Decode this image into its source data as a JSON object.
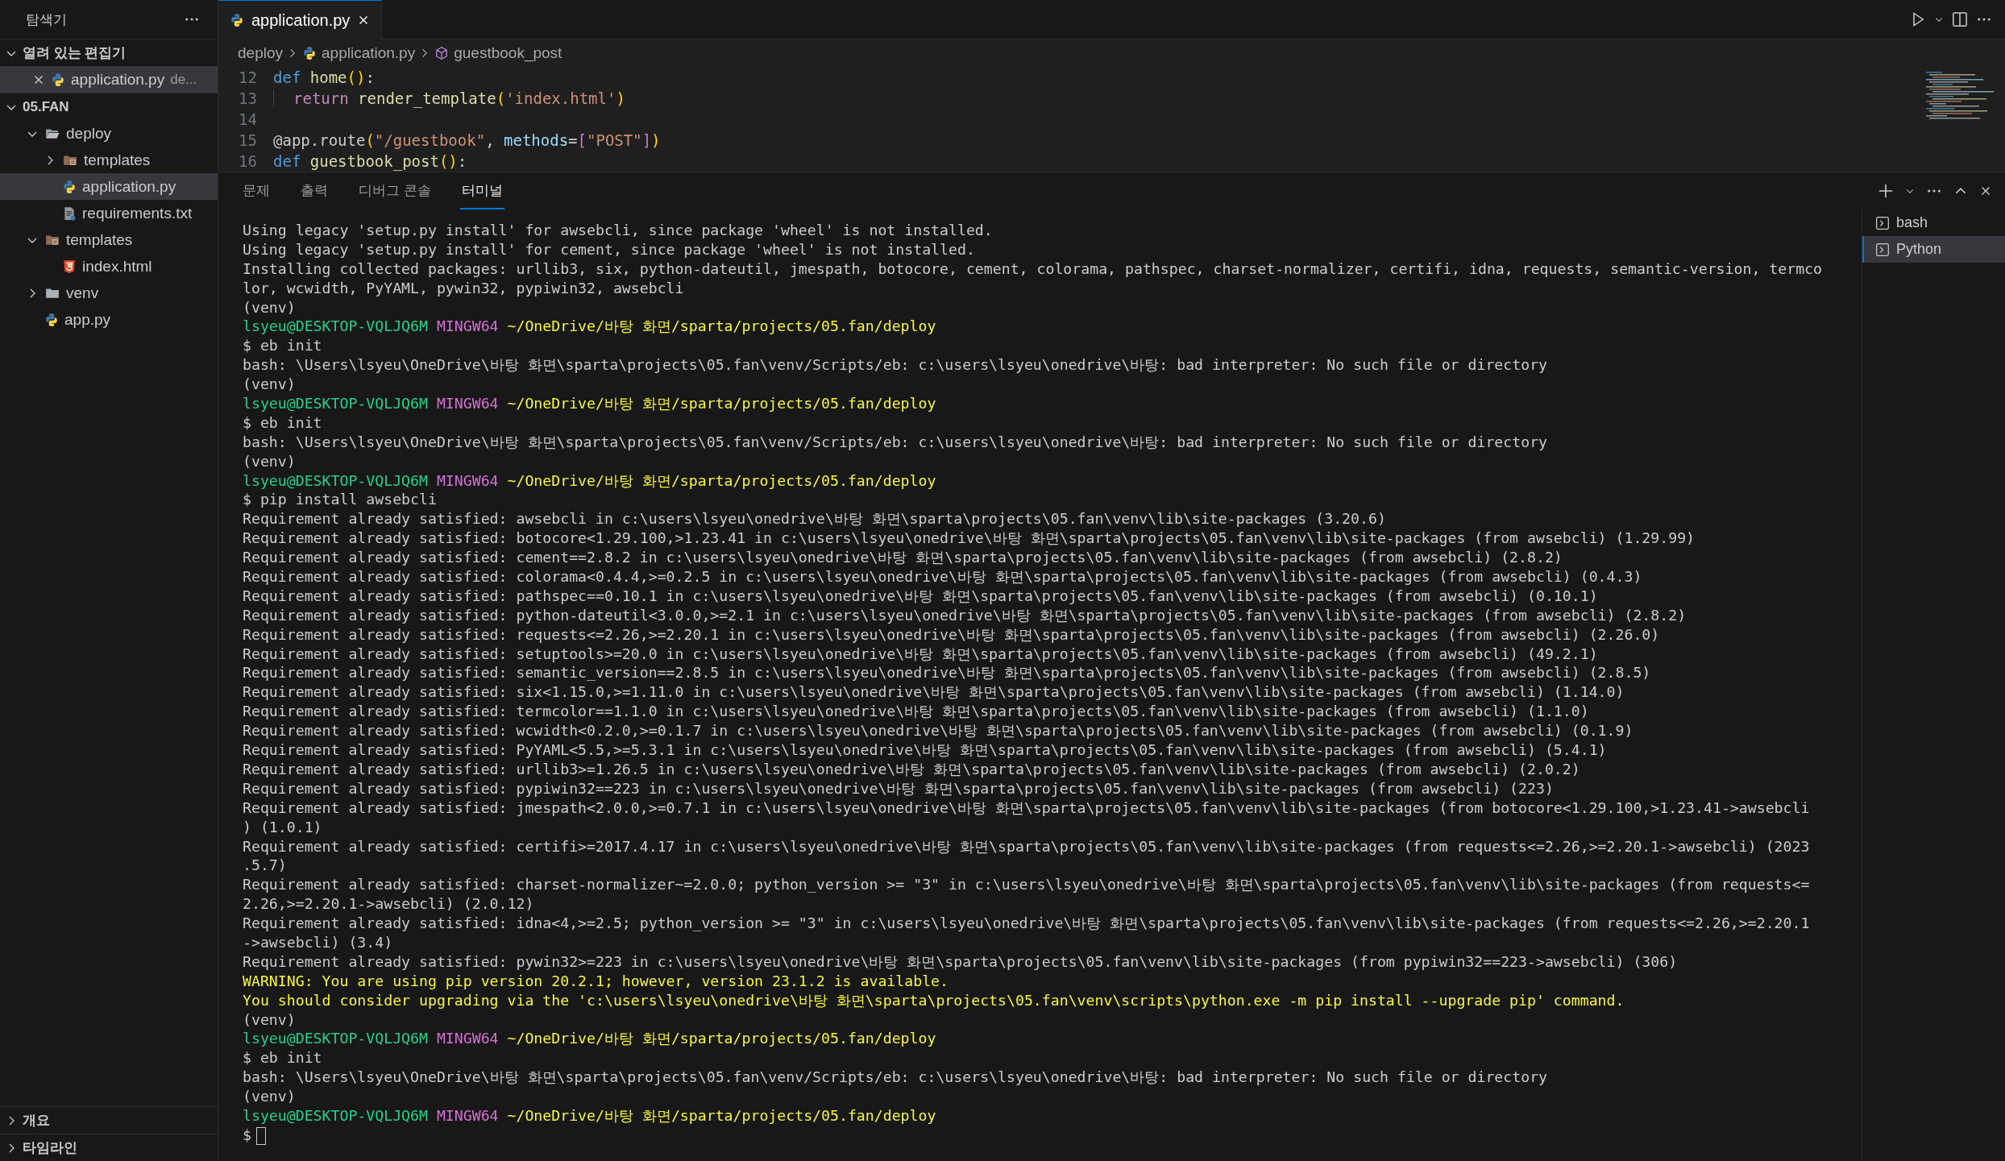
{
  "explorer": {
    "title": "탐색기",
    "sections": [
      {
        "title": "열려 있는 편집기",
        "expanded": true,
        "items": [
          {
            "label": "application.py",
            "description": "de...",
            "kind": "python",
            "selected": true
          }
        ]
      },
      {
        "title": "05.FAN",
        "expanded": true,
        "tree": [
          {
            "label": "deploy",
            "kind": "folder",
            "expanded": true,
            "selected": false,
            "children": [
              {
                "label": "templates",
                "kind": "template-folder",
                "expanded": false,
                "selected": false
              },
              {
                "label": "application.py",
                "kind": "python",
                "selected": true
              },
              {
                "label": "requirements.txt",
                "kind": "text",
                "selected": false
              }
            ]
          },
          {
            "label": "templates",
            "kind": "template-folder",
            "expanded": true,
            "selected": false,
            "children": [
              {
                "label": "index.html",
                "kind": "html",
                "selected": false
              }
            ]
          },
          {
            "label": "venv",
            "kind": "folder",
            "expanded": false,
            "selected": false
          },
          {
            "label": "app.py",
            "kind": "python",
            "selected": false
          }
        ]
      },
      {
        "title": "개요",
        "expanded": false
      },
      {
        "title": "타임라인",
        "expanded": false
      }
    ]
  },
  "editor": {
    "tabs": [
      {
        "label": "application.py",
        "kind": "python",
        "selected": true
      }
    ],
    "breadcrumb": [
      {
        "label": "deploy",
        "kind": "folder"
      },
      {
        "label": "application.py",
        "kind": "python"
      },
      {
        "label": "guestbook_post",
        "kind": "symbol"
      }
    ],
    "lines": [
      {
        "number": "12",
        "tokens": [
          {
            "text": "def",
            "kind": "keyword"
          },
          {
            "text": " home",
            "kind": "function"
          },
          {
            "text": "()",
            "kind": "bracket"
          },
          {
            "text": ":",
            "kind": "plain"
          }
        ]
      },
      {
        "number": "13",
        "indented": true,
        "tokens": [
          {
            "text": "return",
            "kind": "control"
          },
          {
            "text": " render_template",
            "kind": "function"
          },
          {
            "text": "(",
            "kind": "bracket"
          },
          {
            "text": "'index.html'",
            "kind": "string"
          },
          {
            "text": ")",
            "kind": "bracket"
          }
        ]
      },
      {
        "number": "14"
      },
      {
        "number": "15",
        "tokens": [
          {
            "text": "@app.route",
            "kind": "plain"
          },
          {
            "text": "(",
            "kind": "bracket"
          },
          {
            "text": "\"/guestbook\"",
            "kind": "string"
          },
          {
            "text": ", ",
            "kind": "plain"
          },
          {
            "text": "methods",
            "kind": "param"
          },
          {
            "text": "=",
            "kind": "plain"
          },
          {
            "text": "[",
            "kind": "bracket2"
          },
          {
            "text": "\"POST\"",
            "kind": "string"
          },
          {
            "text": "]",
            "kind": "bracket2"
          },
          {
            "text": ")",
            "kind": "bracket"
          }
        ]
      },
      {
        "number": "16",
        "tokens": [
          {
            "text": "def",
            "kind": "keyword"
          },
          {
            "text": " guestbook_post",
            "kind": "function"
          },
          {
            "text": "()",
            "kind": "bracket"
          },
          {
            "text": ":",
            "kind": "plain"
          }
        ]
      }
    ]
  },
  "panel": {
    "tabs": [
      {
        "label": "문제",
        "selected": false
      },
      {
        "label": "출력",
        "selected": false
      },
      {
        "label": "디버그 콘솔",
        "selected": false
      },
      {
        "label": "터미널",
        "selected": true
      }
    ],
    "terminals": [
      {
        "label": "bash",
        "selected": false
      },
      {
        "label": "Python",
        "selected": true
      }
    ],
    "lines": [
      {
        "kind": "text",
        "text": "Using legacy 'setup.py install' for awsebcli, since package 'wheel' is not installed."
      },
      {
        "kind": "text",
        "text": "Using legacy 'setup.py install' for cement, since package 'wheel' is not installed."
      },
      {
        "kind": "text",
        "text": "Installing collected packages: urllib3, six, python-dateutil, jmespath, botocore, cement, colorama, pathspec, charset-normalizer, certifi, idna, requests, semantic-version, termco"
      },
      {
        "kind": "text",
        "text": "lor, wcwidth, PyYAML, pywin32, pypiwin32, awsebcli"
      },
      {
        "kind": "text",
        "text": "(venv)"
      },
      {
        "kind": "prompt",
        "user": "lsyeu@DESKTOP-VQLJQ6M",
        "host": "MINGW64",
        "path": "~/OneDrive/바탕 화면/sparta/projects/05.fan/deploy"
      },
      {
        "kind": "text",
        "text": "$ eb init"
      },
      {
        "kind": "text",
        "text": "bash: \\Users\\lsyeu\\OneDrive\\바탕 화면\\sparta\\projects\\05.fan\\venv/Scripts/eb: c:\\users\\lsyeu\\onedrive\\바탕: bad interpreter: No such file or directory"
      },
      {
        "kind": "text",
        "text": "(venv)"
      },
      {
        "kind": "prompt",
        "user": "lsyeu@DESKTOP-VQLJQ6M",
        "host": "MINGW64",
        "path": "~/OneDrive/바탕 화면/sparta/projects/05.fan/deploy"
      },
      {
        "kind": "text",
        "text": "$ eb init"
      },
      {
        "kind": "text",
        "text": "bash: \\Users\\lsyeu\\OneDrive\\바탕 화면\\sparta\\projects\\05.fan\\venv/Scripts/eb: c:\\users\\lsyeu\\onedrive\\바탕: bad interpreter: No such file or directory"
      },
      {
        "kind": "text",
        "text": "(venv)"
      },
      {
        "kind": "prompt",
        "user": "lsyeu@DESKTOP-VQLJQ6M",
        "host": "MINGW64",
        "path": "~/OneDrive/바탕 화면/sparta/projects/05.fan/deploy"
      },
      {
        "kind": "text",
        "text": "$ pip install awsebcli"
      },
      {
        "kind": "text",
        "text": "Requirement already satisfied: awsebcli in c:\\users\\lsyeu\\onedrive\\바탕 화면\\sparta\\projects\\05.fan\\venv\\lib\\site-packages (3.20.6)"
      },
      {
        "kind": "text",
        "text": "Requirement already satisfied: botocore<1.29.100,>1.23.41 in c:\\users\\lsyeu\\onedrive\\바탕 화면\\sparta\\projects\\05.fan\\venv\\lib\\site-packages (from awsebcli) (1.29.99)"
      },
      {
        "kind": "text",
        "text": "Requirement already satisfied: cement==2.8.2 in c:\\users\\lsyeu\\onedrive\\바탕 화면\\sparta\\projects\\05.fan\\venv\\lib\\site-packages (from awsebcli) (2.8.2)"
      },
      {
        "kind": "text",
        "text": "Requirement already satisfied: colorama<0.4.4,>=0.2.5 in c:\\users\\lsyeu\\onedrive\\바탕 화면\\sparta\\projects\\05.fan\\venv\\lib\\site-packages (from awsebcli) (0.4.3)"
      },
      {
        "kind": "text",
        "text": "Requirement already satisfied: pathspec==0.10.1 in c:\\users\\lsyeu\\onedrive\\바탕 화면\\sparta\\projects\\05.fan\\venv\\lib\\site-packages (from awsebcli) (0.10.1)"
      },
      {
        "kind": "text",
        "text": "Requirement already satisfied: python-dateutil<3.0.0,>=2.1 in c:\\users\\lsyeu\\onedrive\\바탕 화면\\sparta\\projects\\05.fan\\venv\\lib\\site-packages (from awsebcli) (2.8.2)"
      },
      {
        "kind": "text",
        "text": "Requirement already satisfied: requests<=2.26,>=2.20.1 in c:\\users\\lsyeu\\onedrive\\바탕 화면\\sparta\\projects\\05.fan\\venv\\lib\\site-packages (from awsebcli) (2.26.0)"
      },
      {
        "kind": "text",
        "text": "Requirement already satisfied: setuptools>=20.0 in c:\\users\\lsyeu\\onedrive\\바탕 화면\\sparta\\projects\\05.fan\\venv\\lib\\site-packages (from awsebcli) (49.2.1)"
      },
      {
        "kind": "text",
        "text": "Requirement already satisfied: semantic_version==2.8.5 in c:\\users\\lsyeu\\onedrive\\바탕 화면\\sparta\\projects\\05.fan\\venv\\lib\\site-packages (from awsebcli) (2.8.5)"
      },
      {
        "kind": "text",
        "text": "Requirement already satisfied: six<1.15.0,>=1.11.0 in c:\\users\\lsyeu\\onedrive\\바탕 화면\\sparta\\projects\\05.fan\\venv\\lib\\site-packages (from awsebcli) (1.14.0)"
      },
      {
        "kind": "text",
        "text": "Requirement already satisfied: termcolor==1.1.0 in c:\\users\\lsyeu\\onedrive\\바탕 화면\\sparta\\projects\\05.fan\\venv\\lib\\site-packages (from awsebcli) (1.1.0)"
      },
      {
        "kind": "text",
        "text": "Requirement already satisfied: wcwidth<0.2.0,>=0.1.7 in c:\\users\\lsyeu\\onedrive\\바탕 화면\\sparta\\projects\\05.fan\\venv\\lib\\site-packages (from awsebcli) (0.1.9)"
      },
      {
        "kind": "text",
        "text": "Requirement already satisfied: PyYAML<5.5,>=5.3.1 in c:\\users\\lsyeu\\onedrive\\바탕 화면\\sparta\\projects\\05.fan\\venv\\lib\\site-packages (from awsebcli) (5.4.1)"
      },
      {
        "kind": "text",
        "text": "Requirement already satisfied: urllib3>=1.26.5 in c:\\users\\lsyeu\\onedrive\\바탕 화면\\sparta\\projects\\05.fan\\venv\\lib\\site-packages (from awsebcli) (2.0.2)"
      },
      {
        "kind": "text",
        "text": "Requirement already satisfied: pypiwin32==223 in c:\\users\\lsyeu\\onedrive\\바탕 화면\\sparta\\projects\\05.fan\\venv\\lib\\site-packages (from awsebcli) (223)"
      },
      {
        "kind": "text",
        "text": "Requirement already satisfied: jmespath<2.0.0,>=0.7.1 in c:\\users\\lsyeu\\onedrive\\바탕 화면\\sparta\\projects\\05.fan\\venv\\lib\\site-packages (from botocore<1.29.100,>1.23.41->awsebcli"
      },
      {
        "kind": "text",
        "text": ") (1.0.1)"
      },
      {
        "kind": "text",
        "text": "Requirement already satisfied: certifi>=2017.4.17 in c:\\users\\lsyeu\\onedrive\\바탕 화면\\sparta\\projects\\05.fan\\venv\\lib\\site-packages (from requests<=2.26,>=2.20.1->awsebcli) (2023"
      },
      {
        "kind": "text",
        "text": ".5.7)"
      },
      {
        "kind": "text",
        "text": "Requirement already satisfied: charset-normalizer~=2.0.0; python_version >= \"3\" in c:\\users\\lsyeu\\onedrive\\바탕 화면\\sparta\\projects\\05.fan\\venv\\lib\\site-packages (from requests<="
      },
      {
        "kind": "text",
        "text": "2.26,>=2.20.1->awsebcli) (2.0.12)"
      },
      {
        "kind": "text",
        "text": "Requirement already satisfied: idna<4,>=2.5; python_version >= \"3\" in c:\\users\\lsyeu\\onedrive\\바탕 화면\\sparta\\projects\\05.fan\\venv\\lib\\site-packages (from requests<=2.26,>=2.20.1"
      },
      {
        "kind": "text",
        "text": "->awsebcli) (3.4)"
      },
      {
        "kind": "text",
        "text": "Requirement already satisfied: pywin32>=223 in c:\\users\\lsyeu\\onedrive\\바탕 화면\\sparta\\projects\\05.fan\\venv\\lib\\site-packages (from pypiwin32==223->awsebcli) (306)"
      },
      {
        "kind": "warning",
        "text": "WARNING: You are using pip version 20.2.1; however, version 23.1.2 is available."
      },
      {
        "kind": "warning",
        "text": "You should consider upgrading via the 'c:\\users\\lsyeu\\onedrive\\바탕 화면\\sparta\\projects\\05.fan\\venv\\scripts\\python.exe -m pip install --upgrade pip' command."
      },
      {
        "kind": "text",
        "text": "(venv)"
      },
      {
        "kind": "prompt",
        "user": "lsyeu@DESKTOP-VQLJQ6M",
        "host": "MINGW64",
        "path": "~/OneDrive/바탕 화면/sparta/projects/05.fan/deploy"
      },
      {
        "kind": "text",
        "text": "$ eb init"
      },
      {
        "kind": "text",
        "text": "bash: \\Users\\lsyeu\\OneDrive\\바탕 화면\\sparta\\projects\\05.fan\\venv/Scripts/eb: c:\\users\\lsyeu\\onedrive\\바탕: bad interpreter: No such file or directory"
      },
      {
        "kind": "text",
        "text": "(venv)"
      },
      {
        "kind": "prompt",
        "user": "lsyeu@DESKTOP-VQLJQ6M",
        "host": "MINGW64",
        "path": "~/OneDrive/바탕 화면/sparta/projects/05.fan/deploy"
      },
      {
        "kind": "input",
        "text": "$"
      }
    ]
  }
}
